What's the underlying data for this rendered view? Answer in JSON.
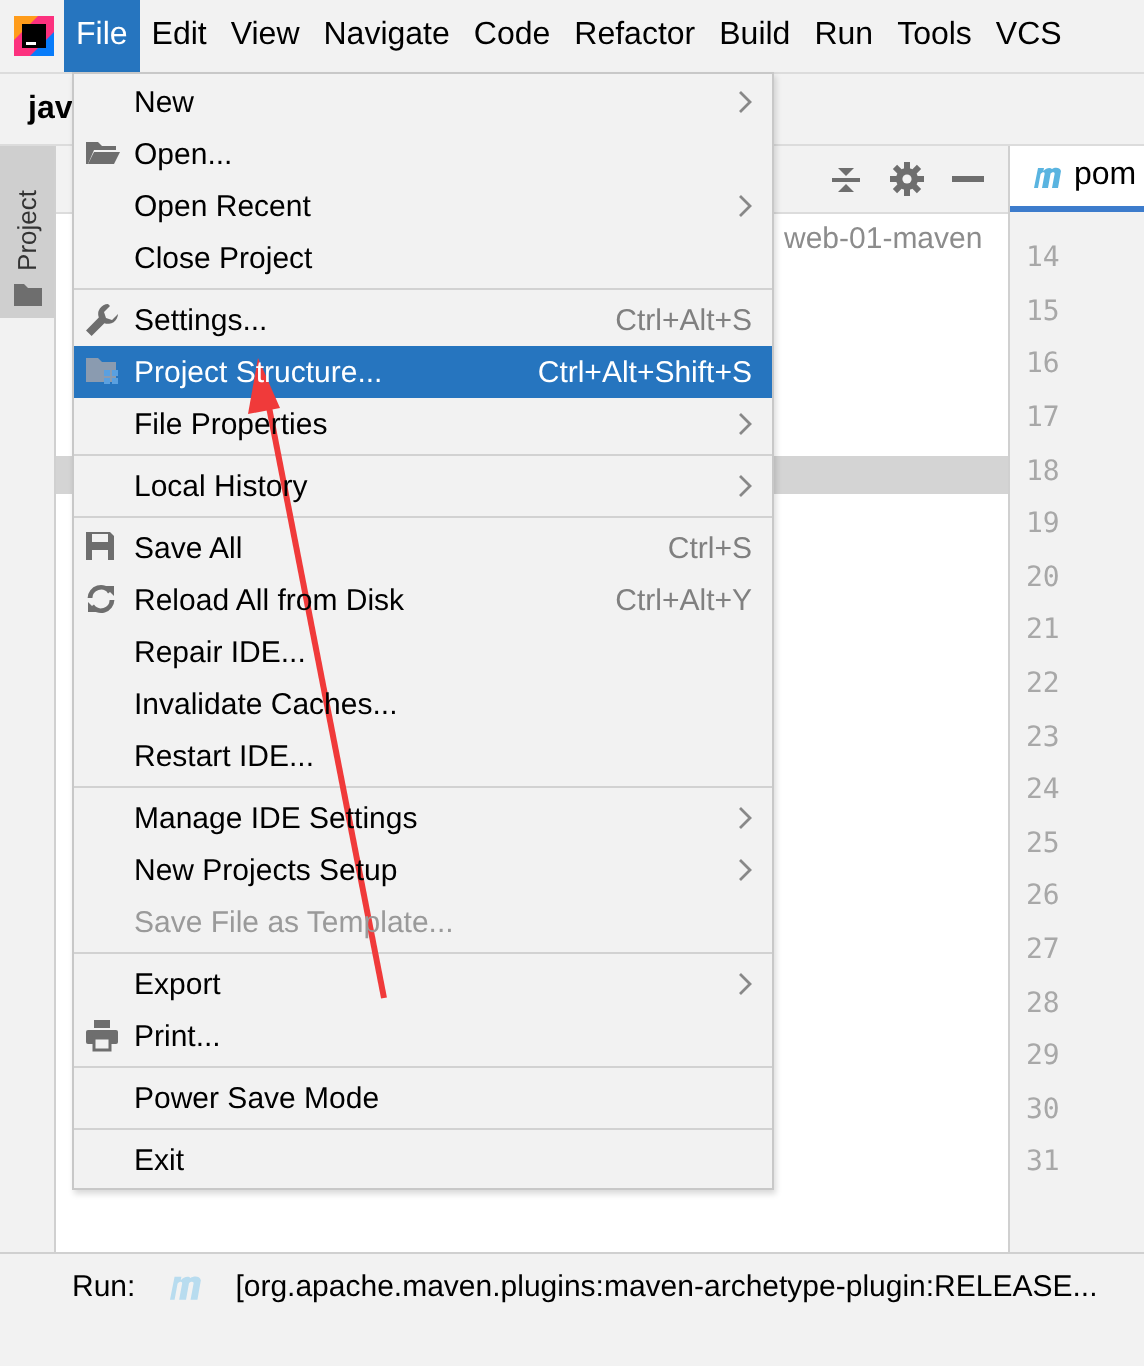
{
  "menubar": [
    {
      "label": "File",
      "selected": true
    },
    {
      "label": "Edit",
      "selected": false
    },
    {
      "label": "View",
      "selected": false
    },
    {
      "label": "Navigate",
      "selected": false
    },
    {
      "label": "Code",
      "selected": false
    },
    {
      "label": "Refactor",
      "selected": false
    },
    {
      "label": "Build",
      "selected": false
    },
    {
      "label": "Run",
      "selected": false
    },
    {
      "label": "Tools",
      "selected": false
    },
    {
      "label": "VCS",
      "selected": false
    }
  ],
  "navbar": {
    "title": "jav"
  },
  "side_tab": {
    "label": "Project"
  },
  "project_panel": {
    "root_label": "web-01-maven"
  },
  "editor": {
    "tab": "pom",
    "line_numbers": [
      "14",
      "15",
      "16",
      "17",
      "18",
      "19",
      "20",
      "21",
      "22",
      "23",
      "24",
      "25",
      "26",
      "27",
      "28",
      "29",
      "30",
      "31"
    ]
  },
  "file_menu_groups": [
    [
      {
        "label": "New",
        "kind": "plain",
        "submenu": true,
        "selected": false,
        "disabled": false
      },
      {
        "label": "Open...",
        "kind": "folder",
        "submenu": false,
        "selected": false,
        "disabled": false
      },
      {
        "label": "Open Recent",
        "kind": "plain",
        "submenu": true,
        "selected": false,
        "disabled": false
      },
      {
        "label": "Close Project",
        "kind": "plain",
        "submenu": false,
        "selected": false,
        "disabled": false
      }
    ],
    [
      {
        "label": "Settings...",
        "kind": "wrench",
        "shortcut": "Ctrl+Alt+S",
        "submenu": false,
        "selected": false,
        "disabled": false
      },
      {
        "label": "Project Structure...",
        "kind": "structure",
        "shortcut": "Ctrl+Alt+Shift+S",
        "submenu": false,
        "selected": true,
        "disabled": false
      },
      {
        "label": "File Properties",
        "kind": "plain",
        "submenu": true,
        "selected": false,
        "disabled": false
      }
    ],
    [
      {
        "label": "Local History",
        "kind": "plain",
        "submenu": true,
        "selected": false,
        "disabled": false
      }
    ],
    [
      {
        "label": "Save All",
        "kind": "save",
        "shortcut": "Ctrl+S",
        "submenu": false,
        "selected": false,
        "disabled": false
      },
      {
        "label": "Reload All from Disk",
        "kind": "reload",
        "shortcut": "Ctrl+Alt+Y",
        "submenu": false,
        "selected": false,
        "disabled": false
      },
      {
        "label": "Repair IDE...",
        "kind": "plain",
        "submenu": false,
        "selected": false,
        "disabled": false
      },
      {
        "label": "Invalidate Caches...",
        "kind": "plain",
        "submenu": false,
        "selected": false,
        "disabled": false
      },
      {
        "label": "Restart IDE...",
        "kind": "plain",
        "submenu": false,
        "selected": false,
        "disabled": false
      }
    ],
    [
      {
        "label": "Manage IDE Settings",
        "kind": "plain",
        "submenu": true,
        "selected": false,
        "disabled": false
      },
      {
        "label": "New Projects Setup",
        "kind": "plain",
        "submenu": true,
        "selected": false,
        "disabled": false
      },
      {
        "label": "Save File as Template...",
        "kind": "plain",
        "submenu": false,
        "selected": false,
        "disabled": true
      }
    ],
    [
      {
        "label": "Export",
        "kind": "plain",
        "submenu": true,
        "selected": false,
        "disabled": false
      },
      {
        "label": "Print...",
        "kind": "print",
        "submenu": false,
        "selected": false,
        "disabled": false
      }
    ],
    [
      {
        "label": "Power Save Mode",
        "kind": "plain",
        "submenu": false,
        "selected": false,
        "disabled": false
      }
    ],
    [
      {
        "label": "Exit",
        "kind": "plain",
        "submenu": false,
        "selected": false,
        "disabled": false
      }
    ]
  ],
  "run_bar": {
    "label": "Run:",
    "task": "[org.apache.maven.plugins:maven-archetype-plugin:RELEASE..."
  }
}
